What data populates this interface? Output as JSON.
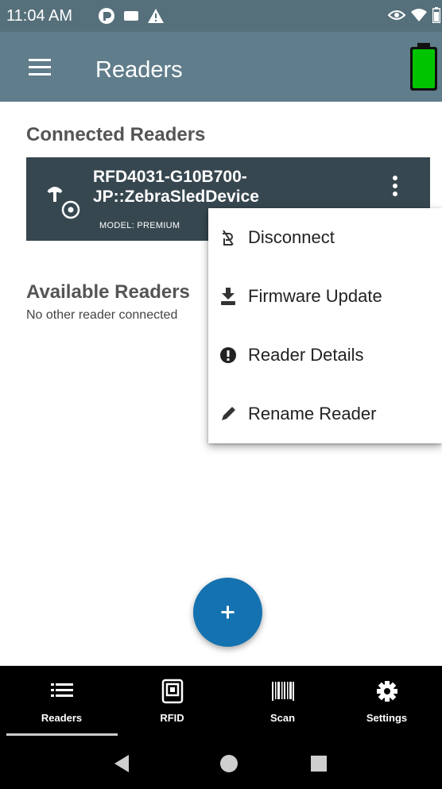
{
  "status_bar": {
    "time": "11:04 AM",
    "icons_left": [
      "gmail-like-icon",
      "message-icon",
      "warning-icon"
    ],
    "icons_right": [
      "eye-icon",
      "wifi-icon",
      "battery-small-icon"
    ]
  },
  "app_bar": {
    "title": "Readers",
    "menu_icon": "hamburger-menu-icon",
    "battery_icon": "battery-full-icon",
    "battery_color": "#00c400"
  },
  "connected": {
    "title": "Connected Readers",
    "reader": {
      "name": "RFD4031-G10B700-JP::ZebraSledDevice",
      "model": "MODEL: PREMIUM"
    }
  },
  "available": {
    "title": "Available Readers",
    "empty_text": "No other reader connected"
  },
  "menu": {
    "items": [
      {
        "label": "Disconnect",
        "icon": "disconnect-icon"
      },
      {
        "label": "Firmware Update",
        "icon": "firmware-update-icon"
      },
      {
        "label": "Reader Details",
        "icon": "info-icon"
      },
      {
        "label": "Rename Reader",
        "icon": "pencil-icon"
      }
    ]
  },
  "fab": {
    "icon": "plus-icon",
    "color": "#1572b0"
  },
  "bottom_nav": {
    "items": [
      {
        "label": "Readers",
        "icon": "list-icon",
        "active": true
      },
      {
        "label": "RFID",
        "icon": "rfid-tag-icon",
        "active": false
      },
      {
        "label": "Scan",
        "icon": "barcode-icon",
        "active": false
      },
      {
        "label": "Settings",
        "icon": "gear-icon",
        "active": false
      }
    ]
  },
  "system_nav": {
    "buttons": [
      "back-icon",
      "home-icon",
      "recents-icon"
    ]
  },
  "colors": {
    "status_bar": "#56707b",
    "app_bar": "#607d8b",
    "card": "#37474f"
  }
}
